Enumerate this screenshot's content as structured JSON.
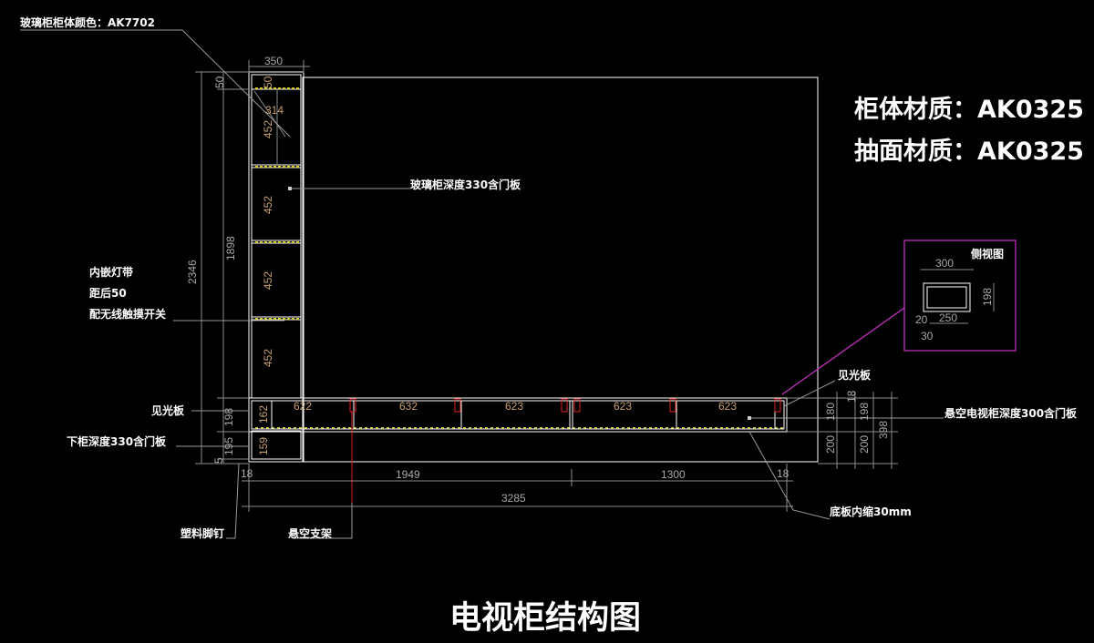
{
  "title": "电视柜结构图",
  "materials": {
    "cabinet": "柜体材质：AK0325",
    "drawer": "抽面材质：AK0325"
  },
  "notes": {
    "glass_color": "玻璃柜柜体颜色：AK7702",
    "glass_depth": "玻璃柜深度330含门板",
    "led_1": "内嵌灯带",
    "led_2": "距后50",
    "led_3": "配无线触摸开关",
    "light_board_left": "见光板",
    "light_board_right": "见光板",
    "lower_depth": "下柜深度330含门板",
    "hanging_depth": "悬空电视柜深度300含门板",
    "bottom_recess": "底板内缩30mm",
    "plastic_foot": "塑料脚钉",
    "hanging_bracket": "悬空支架",
    "side_view": "侧视图"
  },
  "dims": {
    "top_width": "350",
    "left_50": "50",
    "left_1898": "1898",
    "left_2346": "2346",
    "left_198": "198",
    "left_195": "195",
    "left_5": "5",
    "shelf_50": "50",
    "shelf_314": "314",
    "shelf_heights": [
      "452",
      "452",
      "452",
      "452"
    ],
    "inner_162": "162",
    "inner_159": "159",
    "drawer_widths": [
      "622",
      "632",
      "623",
      "623",
      "623"
    ],
    "bottom_18_left": "18",
    "bottom_1949": "1949",
    "bottom_1300": "1300",
    "bottom_18_right": "18",
    "bottom_3285": "3285",
    "right_18": "18",
    "right_180": "180",
    "right_198": "198",
    "right_200a": "200",
    "right_200b": "200",
    "right_398": "398",
    "side_300": "300",
    "side_198": "198",
    "side_20": "20",
    "side_250": "250",
    "side_30": "30"
  }
}
